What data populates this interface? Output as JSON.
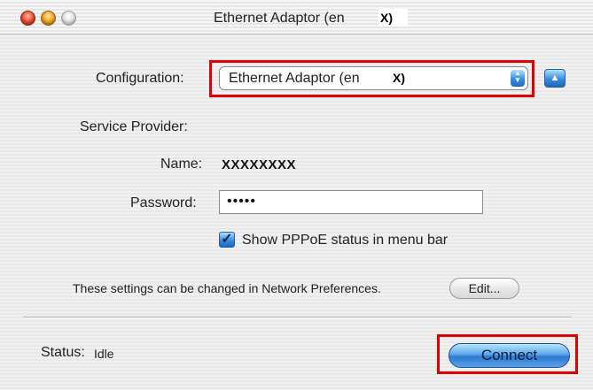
{
  "window": {
    "title": "Ethernet Adaptor (en",
    "title_overlay": "X)"
  },
  "configuration": {
    "label": "Configuration:",
    "value": "Ethernet Adaptor (en",
    "value_overlay": "X)"
  },
  "service_provider": {
    "label": "Service Provider:"
  },
  "name": {
    "label": "Name:",
    "value": "XXXXXXXX"
  },
  "password": {
    "label": "Password:",
    "value": "•••••"
  },
  "show_status": {
    "label": "Show PPPoE status in menu bar",
    "checked": true
  },
  "settings_note": "These settings can be changed in Network Preferences.",
  "edit_button": "Edit...",
  "status": {
    "label": "Status:",
    "value": "Idle"
  },
  "connect_button": "Connect",
  "colors": {
    "highlight_red": "#e20000",
    "aqua_blue": "#3a8ce0"
  }
}
